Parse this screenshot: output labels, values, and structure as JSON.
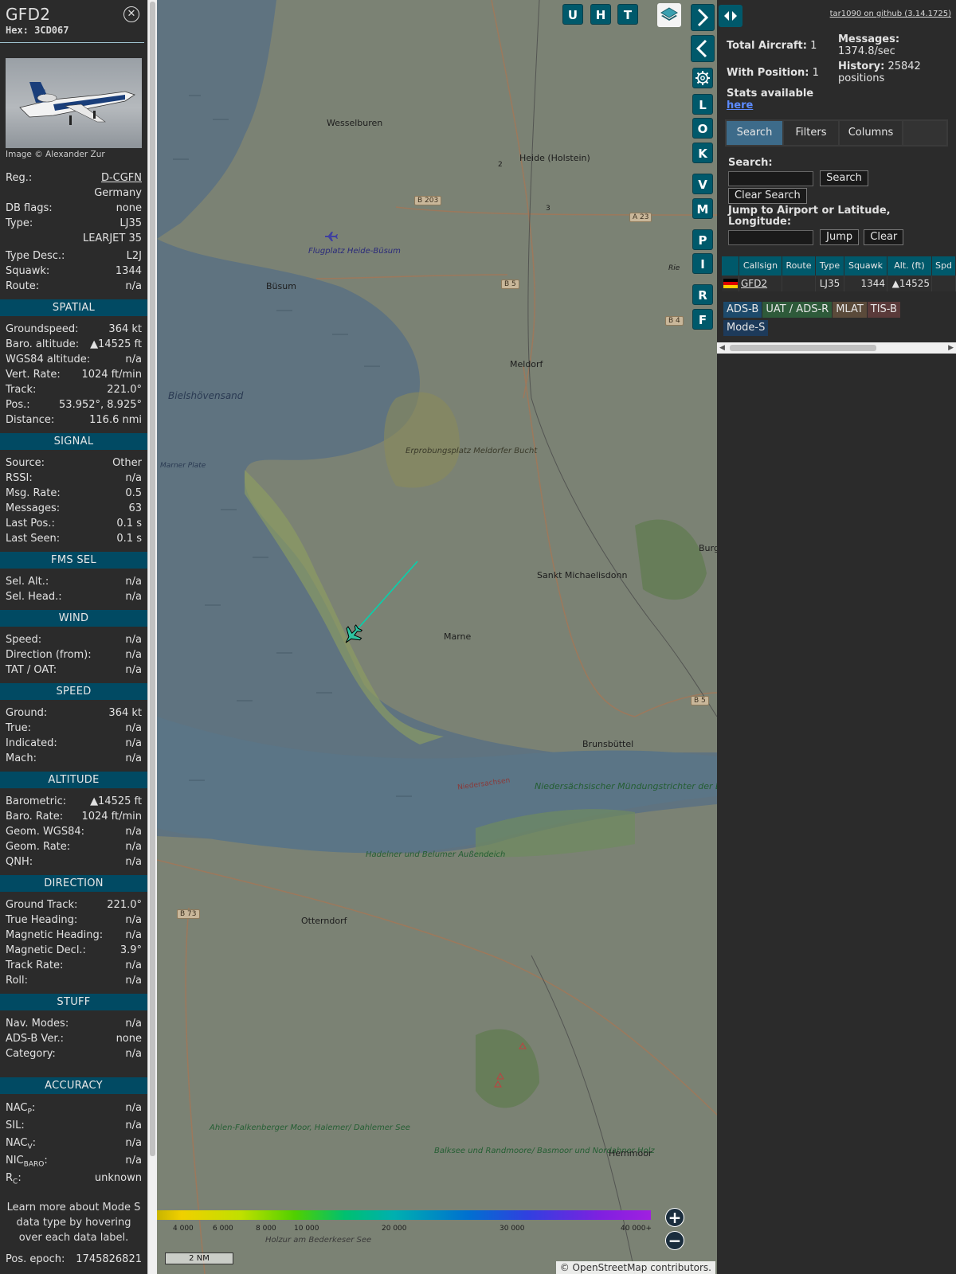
{
  "info": {
    "callsign": "GFD2",
    "hex": "Hex: 3CD067",
    "close_icon": "close-icon",
    "photo_credit": "Image © Alexander Zur",
    "reg_label": "Reg.:",
    "reg_value": "D-CGFN",
    "country": "Germany",
    "dbflags_label": "DB flags:",
    "dbflags_value": "none",
    "type_label": "Type:",
    "type_value": "LJ35",
    "type_name": "LEARJET 35",
    "typedesc_label": "Type Desc.:",
    "typedesc_value": "L2J",
    "squawk_label": "Squawk:",
    "squawk_value": "1344",
    "route_label": "Route:",
    "route_value": "n/a"
  },
  "spatial": {
    "title": "SPATIAL",
    "rows": [
      {
        "l": "Groundspeed:",
        "v": "364 kt"
      },
      {
        "l": "Baro. altitude:",
        "v": "▲14525 ft"
      },
      {
        "l": "WGS84 altitude:",
        "v": "n/a"
      },
      {
        "l": "Vert. Rate:",
        "v": "1024 ft/min"
      },
      {
        "l": "Track:",
        "v": "221.0°"
      },
      {
        "l": "Pos.:",
        "v": "53.952°, 8.925°"
      },
      {
        "l": "Distance:",
        "v": "116.6 nmi"
      }
    ]
  },
  "signal": {
    "title": "SIGNAL",
    "rows": [
      {
        "l": "Source:",
        "v": "Other"
      },
      {
        "l": "RSSI:",
        "v": "n/a"
      },
      {
        "l": "Msg. Rate:",
        "v": "0.5"
      },
      {
        "l": "Messages:",
        "v": "63"
      },
      {
        "l": "Last Pos.:",
        "v": "0.1 s"
      },
      {
        "l": "Last Seen:",
        "v": "0.1 s"
      }
    ]
  },
  "fms": {
    "title": "FMS SEL",
    "rows": [
      {
        "l": "Sel. Alt.:",
        "v": "n/a"
      },
      {
        "l": "Sel. Head.:",
        "v": "n/a"
      }
    ]
  },
  "wind": {
    "title": "WIND",
    "rows": [
      {
        "l": "Speed:",
        "v": "n/a"
      },
      {
        "l": "Direction (from):",
        "v": "n/a"
      },
      {
        "l": "TAT / OAT:",
        "v": "n/a"
      }
    ]
  },
  "speed": {
    "title": "SPEED",
    "rows": [
      {
        "l": "Ground:",
        "v": "364 kt"
      },
      {
        "l": "True:",
        "v": "n/a"
      },
      {
        "l": "Indicated:",
        "v": "n/a"
      },
      {
        "l": "Mach:",
        "v": "n/a"
      }
    ]
  },
  "altitude": {
    "title": "ALTITUDE",
    "rows": [
      {
        "l": "Barometric:",
        "v": "▲14525 ft"
      },
      {
        "l": "Baro. Rate:",
        "v": "1024 ft/min"
      },
      {
        "l": "Geom. WGS84:",
        "v": "n/a"
      },
      {
        "l": "Geom. Rate:",
        "v": "n/a"
      },
      {
        "l": "QNH:",
        "v": "n/a"
      }
    ]
  },
  "direction": {
    "title": "DIRECTION",
    "rows": [
      {
        "l": "Ground Track:",
        "v": "221.0°"
      },
      {
        "l": "True Heading:",
        "v": "n/a"
      },
      {
        "l": "Magnetic Heading:",
        "v": "n/a"
      },
      {
        "l": "Magnetic Decl.:",
        "v": "3.9°"
      },
      {
        "l": "Track Rate:",
        "v": "n/a"
      },
      {
        "l": "Roll:",
        "v": "n/a"
      }
    ]
  },
  "stuff": {
    "title": "STUFF",
    "rows": [
      {
        "l": "Nav. Modes:",
        "v": "n/a"
      },
      {
        "l": "ADS-B Ver.:",
        "v": "none"
      },
      {
        "l": "Category:",
        "v": "n/a"
      }
    ]
  },
  "accuracy": {
    "title": "ACCURACY",
    "nacp": "NAC",
    "nacp_sub": "P",
    "nacp_v": "n/a",
    "sil": "SIL:",
    "sil_v": "n/a",
    "nacv": "NAC",
    "nacv_sub": "V",
    "nacv_v": "n/a",
    "nic": "NIC",
    "nic_sub": "BARO",
    "nic_v": "n/a",
    "rc": "R",
    "rc_sub": "C",
    "rc_v": "unknown"
  },
  "learn_more": "Learn more about Mode S data type by hovering over each data label.",
  "epoch_label": "Pos. epoch:",
  "epoch_value": "1745826821",
  "map": {
    "buttons": [
      "U",
      "H",
      "T"
    ],
    "side_buttons": [
      "L",
      "O",
      "K",
      "V",
      "M",
      "P",
      "I",
      "R",
      "F"
    ],
    "places": {
      "wesselburen": "Wesselburen",
      "heide": "Heide (Holstein)",
      "busum": "Büsum",
      "flugplatz": "Flugplatz Heide-Büsum",
      "meldorf": "Meldorf",
      "bielshoven": "Bielshövensand",
      "erprobung": "Erprobungsplatz Meldorfer Bucht",
      "marner": "Marner Plate",
      "sanktm": "Sankt Michaelisdonn",
      "marne": "Marne",
      "brunsbuttel": "Brunsbüttel",
      "nieders": "Niedersachsen",
      "mundung": "Niedersächsischer Mündungstrichter der Elbe",
      "hadelner": "Hadelner und Belumer Außendeich",
      "otterndorf": "Otterndorf",
      "ahlen": "Ahlen-Falkenberger Moor, Halemer/ Dahlemer See",
      "balksee": "Balksee und Randmoore/ Basmoor und Nordahner Holz",
      "hemmoor": "Hemmoor",
      "burg": "Burg",
      "rie": "Rie",
      "holz2": "Holzur am Bederkeser See"
    },
    "roads": [
      "B 203",
      "A 23",
      "B 5",
      "B 4",
      "B 73",
      "B 5"
    ],
    "road_nums": [
      "2",
      "3"
    ],
    "alt_labels": [
      "4 000",
      "6 000",
      "8 000",
      "10 000",
      "20 000",
      "30 000",
      "40 000+"
    ],
    "scale": "2 NM",
    "attribution": "© OpenStreetMap contributors.",
    "zoom_in": "+",
    "zoom_out": "−"
  },
  "right": {
    "github": "tar1090 on github (3.14.1725)",
    "total_label": "Total Aircraft:",
    "total_value": "1",
    "withpos_label": "With Position:",
    "withpos_value": "1",
    "messages_label": "Messages:",
    "messages_value": "1374.8/sec",
    "history_label": "History:",
    "history_value": "25842 positions",
    "stats_text": "Stats available",
    "stats_link": "here",
    "tabs": [
      "Search",
      "Filters",
      "Columns"
    ],
    "search_label": "Search:",
    "search_btn": "Search",
    "clear_search_btn": "Clear Search",
    "jump_label": "Jump to Airport or Latitude, Longitude:",
    "jump_btn": "Jump",
    "clear_btn": "Clear",
    "columns": [
      "",
      "Callsign",
      "Route",
      "Type",
      "Squawk",
      "Alt. (ft)",
      "Spd"
    ],
    "row": {
      "callsign": "GFD2",
      "route": "",
      "type": "LJ35",
      "squawk": "1344",
      "alt": "▲14525",
      "spd": ""
    },
    "legend": [
      "ADS-B",
      "UAT / ADS-R",
      "MLAT",
      "TIS-B",
      "Mode-S"
    ]
  }
}
